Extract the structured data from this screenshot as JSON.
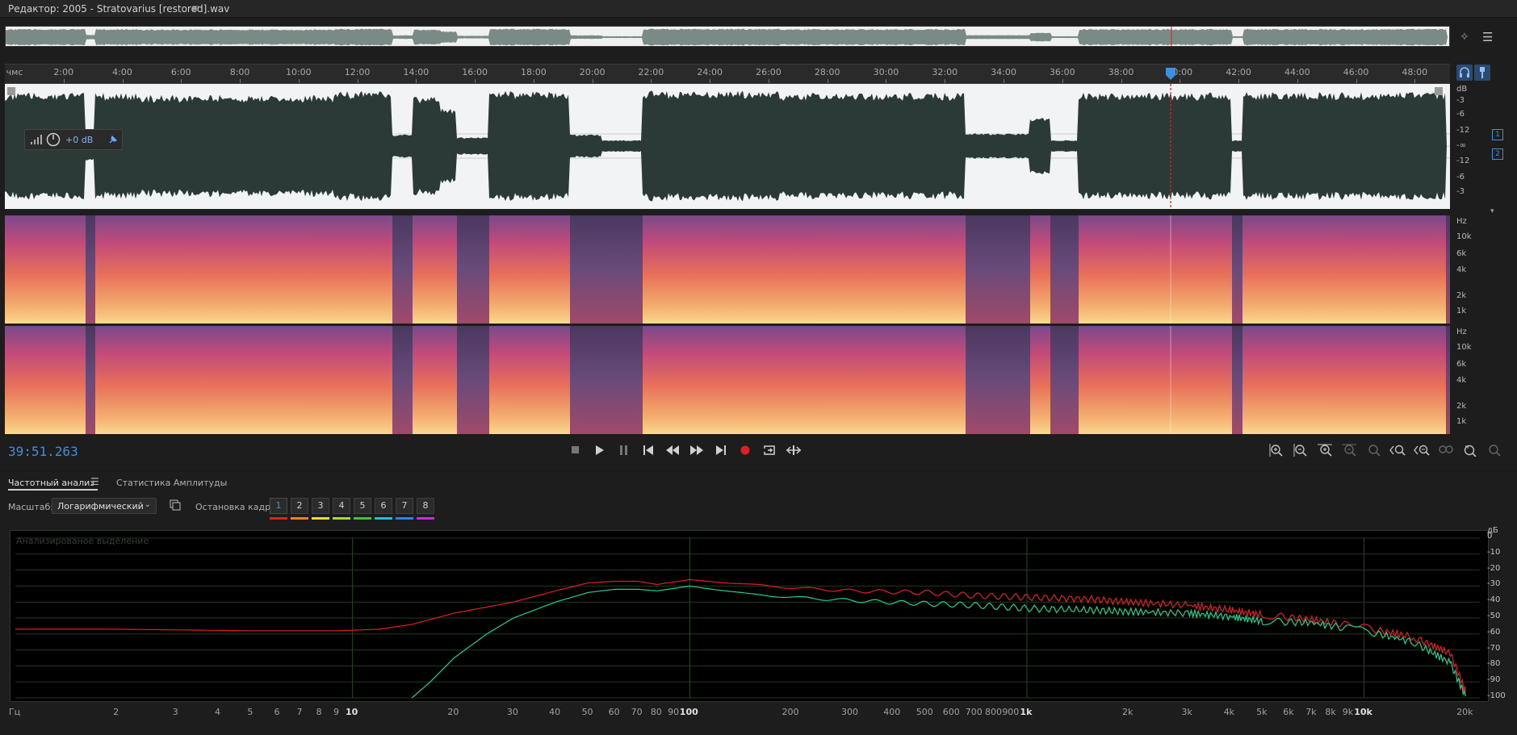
{
  "window": {
    "title": "Редактор: 2005 - Stratovarius [restored].wav",
    "menu_icon": "hamburger-icon"
  },
  "ruler": {
    "unit": "чмс",
    "labels": [
      "2:00",
      "4:00",
      "6:00",
      "8:00",
      "10:00",
      "12:00",
      "14:00",
      "16:00",
      "18:00",
      "20:00",
      "22:00",
      "24:00",
      "26:00",
      "28:00",
      "30:00",
      "32:00",
      "34:00",
      "36:00",
      "38:00",
      "40:00",
      "42:00",
      "44:00",
      "46:00",
      "48:00"
    ]
  },
  "waveform": {
    "db_labels": [
      "dB",
      "-3",
      "-6",
      "-12",
      "-∞",
      "-12",
      "-6",
      "-3"
    ],
    "channel_labels": [
      "1",
      "2"
    ],
    "hud_gain": "+0 dB",
    "colors": {
      "background": "#f2f3f5",
      "wave": "#2b3a36",
      "playhead": "#e02020"
    }
  },
  "spectrogram": {
    "hz_labels": [
      "Hz",
      "10k",
      "6k",
      "4k",
      "2k",
      "1k"
    ]
  },
  "transport": {
    "timecode": "39:51.263",
    "buttons": [
      "stop-icon",
      "play-icon",
      "pause-icon",
      "skip-to-start-icon",
      "rewind-icon",
      "fast-forward-icon",
      "skip-to-end-icon",
      "record-icon",
      "loop-icon",
      "skip-selection-icon"
    ],
    "zoom_buttons": [
      "zoom-in-amplitude-icon",
      "zoom-out-amplitude-icon",
      "zoom-in-time-icon",
      "zoom-out-time-icon",
      "zoom-in-left-icon",
      "zoom-in-right-icon",
      "zoom-out-full-icon",
      "zoom-in-selection-icon",
      "zoom-reset-icon",
      "zoom-max-icon"
    ]
  },
  "panel": {
    "tab_frequency": "Частотный анализ",
    "tab_amplitude": "Статистика Амплитуды",
    "scale_label": "Масштаб:",
    "scale_value": "Логарифмический",
    "freeze_label": "Остановка кадра:",
    "freeze_buttons": [
      "1",
      "2",
      "3",
      "4",
      "5",
      "6",
      "7",
      "8"
    ],
    "freeze_colors": [
      "#e02020",
      "#f08020",
      "#e8e020",
      "#a0e020",
      "#40c040",
      "#20c0d0",
      "#3080f0",
      "#e020e0"
    ],
    "overlay_text": "Анализированое выделение"
  },
  "chart_data": {
    "type": "line",
    "title": "",
    "xlabel": "Гц",
    "ylabel": "дБ",
    "x_scale": "log",
    "xlim": [
      1,
      22050
    ],
    "ylim": [
      -100,
      0
    ],
    "x_tick_labels": [
      "Гц",
      "2",
      "3",
      "4",
      "5",
      "6",
      "7",
      "8",
      "9",
      "10",
      "20",
      "30",
      "40",
      "50",
      "60",
      "70",
      "80",
      "90",
      "100",
      "200",
      "300",
      "400",
      "500",
      "600",
      "700",
      "800",
      "900",
      "1k",
      "2k",
      "3k",
      "4k",
      "5k",
      "6k",
      "7k",
      "8k",
      "9k",
      "10k",
      "20k"
    ],
    "y_tick_labels": [
      "дБ",
      "0",
      "-10",
      "-20",
      "-30",
      "-40",
      "-50",
      "-60",
      "-70",
      "-80",
      "-90",
      "-100"
    ],
    "grid": true,
    "series": [
      {
        "color": "#e02020",
        "x": [
          1,
          2,
          5,
          9,
          12,
          15,
          20,
          30,
          40,
          50,
          60,
          70,
          80,
          100,
          150,
          200,
          300,
          500,
          700,
          1000,
          1500,
          2000,
          3000,
          4000,
          5000,
          7000,
          10000,
          14000,
          18000,
          20000
        ],
        "y": [
          -57,
          -57,
          -58,
          -58,
          -57,
          -54,
          -47,
          -40,
          -33,
          -28,
          -27,
          -27,
          -29,
          -26,
          -29,
          -31,
          -33,
          -34,
          -36,
          -37,
          -38,
          -40,
          -42,
          -45,
          -48,
          -51,
          -56,
          -62,
          -72,
          -96
        ]
      },
      {
        "color": "#20d090",
        "x": [
          15,
          17,
          20,
          25,
          30,
          40,
          50,
          60,
          70,
          80,
          100,
          150,
          200,
          300,
          500,
          700,
          1000,
          1500,
          2000,
          3000,
          4000,
          5000,
          7000,
          10000,
          14000,
          18000,
          20000
        ],
        "y": [
          -100,
          -90,
          -75,
          -60,
          -50,
          -40,
          -34,
          -32,
          -32,
          -33,
          -30,
          -35,
          -37,
          -39,
          -41,
          -42,
          -44,
          -45,
          -46,
          -47,
          -49,
          -52,
          -53,
          -58,
          -65,
          -78,
          -99
        ]
      }
    ]
  }
}
